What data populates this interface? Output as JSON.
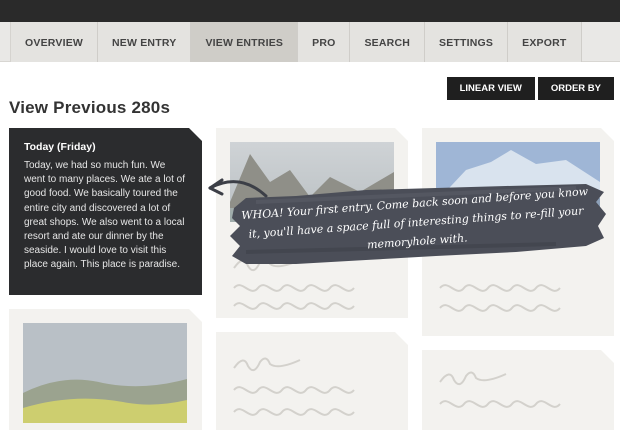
{
  "nav": {
    "items": [
      {
        "label": "OVERVIEW"
      },
      {
        "label": "NEW ENTRY"
      },
      {
        "label": "VIEW ENTRIES"
      },
      {
        "label": "PRO"
      },
      {
        "label": "SEARCH"
      },
      {
        "label": "SETTINGS"
      },
      {
        "label": "EXPORT"
      }
    ],
    "active": "VIEW ENTRIES"
  },
  "view_buttons": {
    "linear": "LINEAR VIEW",
    "order": "ORDER BY"
  },
  "page_title": "View Previous 280s",
  "entry": {
    "date": "Today (Friday)",
    "text": "Today, we had so much fun. We went to many places. We ate a lot of good food. We basically toured the entire city and discovered a lot of great shops. We also went to a local resort and ate our dinner by the seaside. I would love to visit this place again. This place is paradise."
  },
  "banner": {
    "text": "WHOA! Your first entry. Come back soon and before you know it, you'll have a space full of interesting things to re-fill your memoryhole with."
  },
  "colors": {
    "topbar": "#2a2a2a",
    "nav_bg": "#e4e3e0",
    "nav_active": "#cfcdc8",
    "entry_card": "#2b2c2e",
    "placeholder_card": "#f3f2ef",
    "banner": "#4b4e58"
  }
}
